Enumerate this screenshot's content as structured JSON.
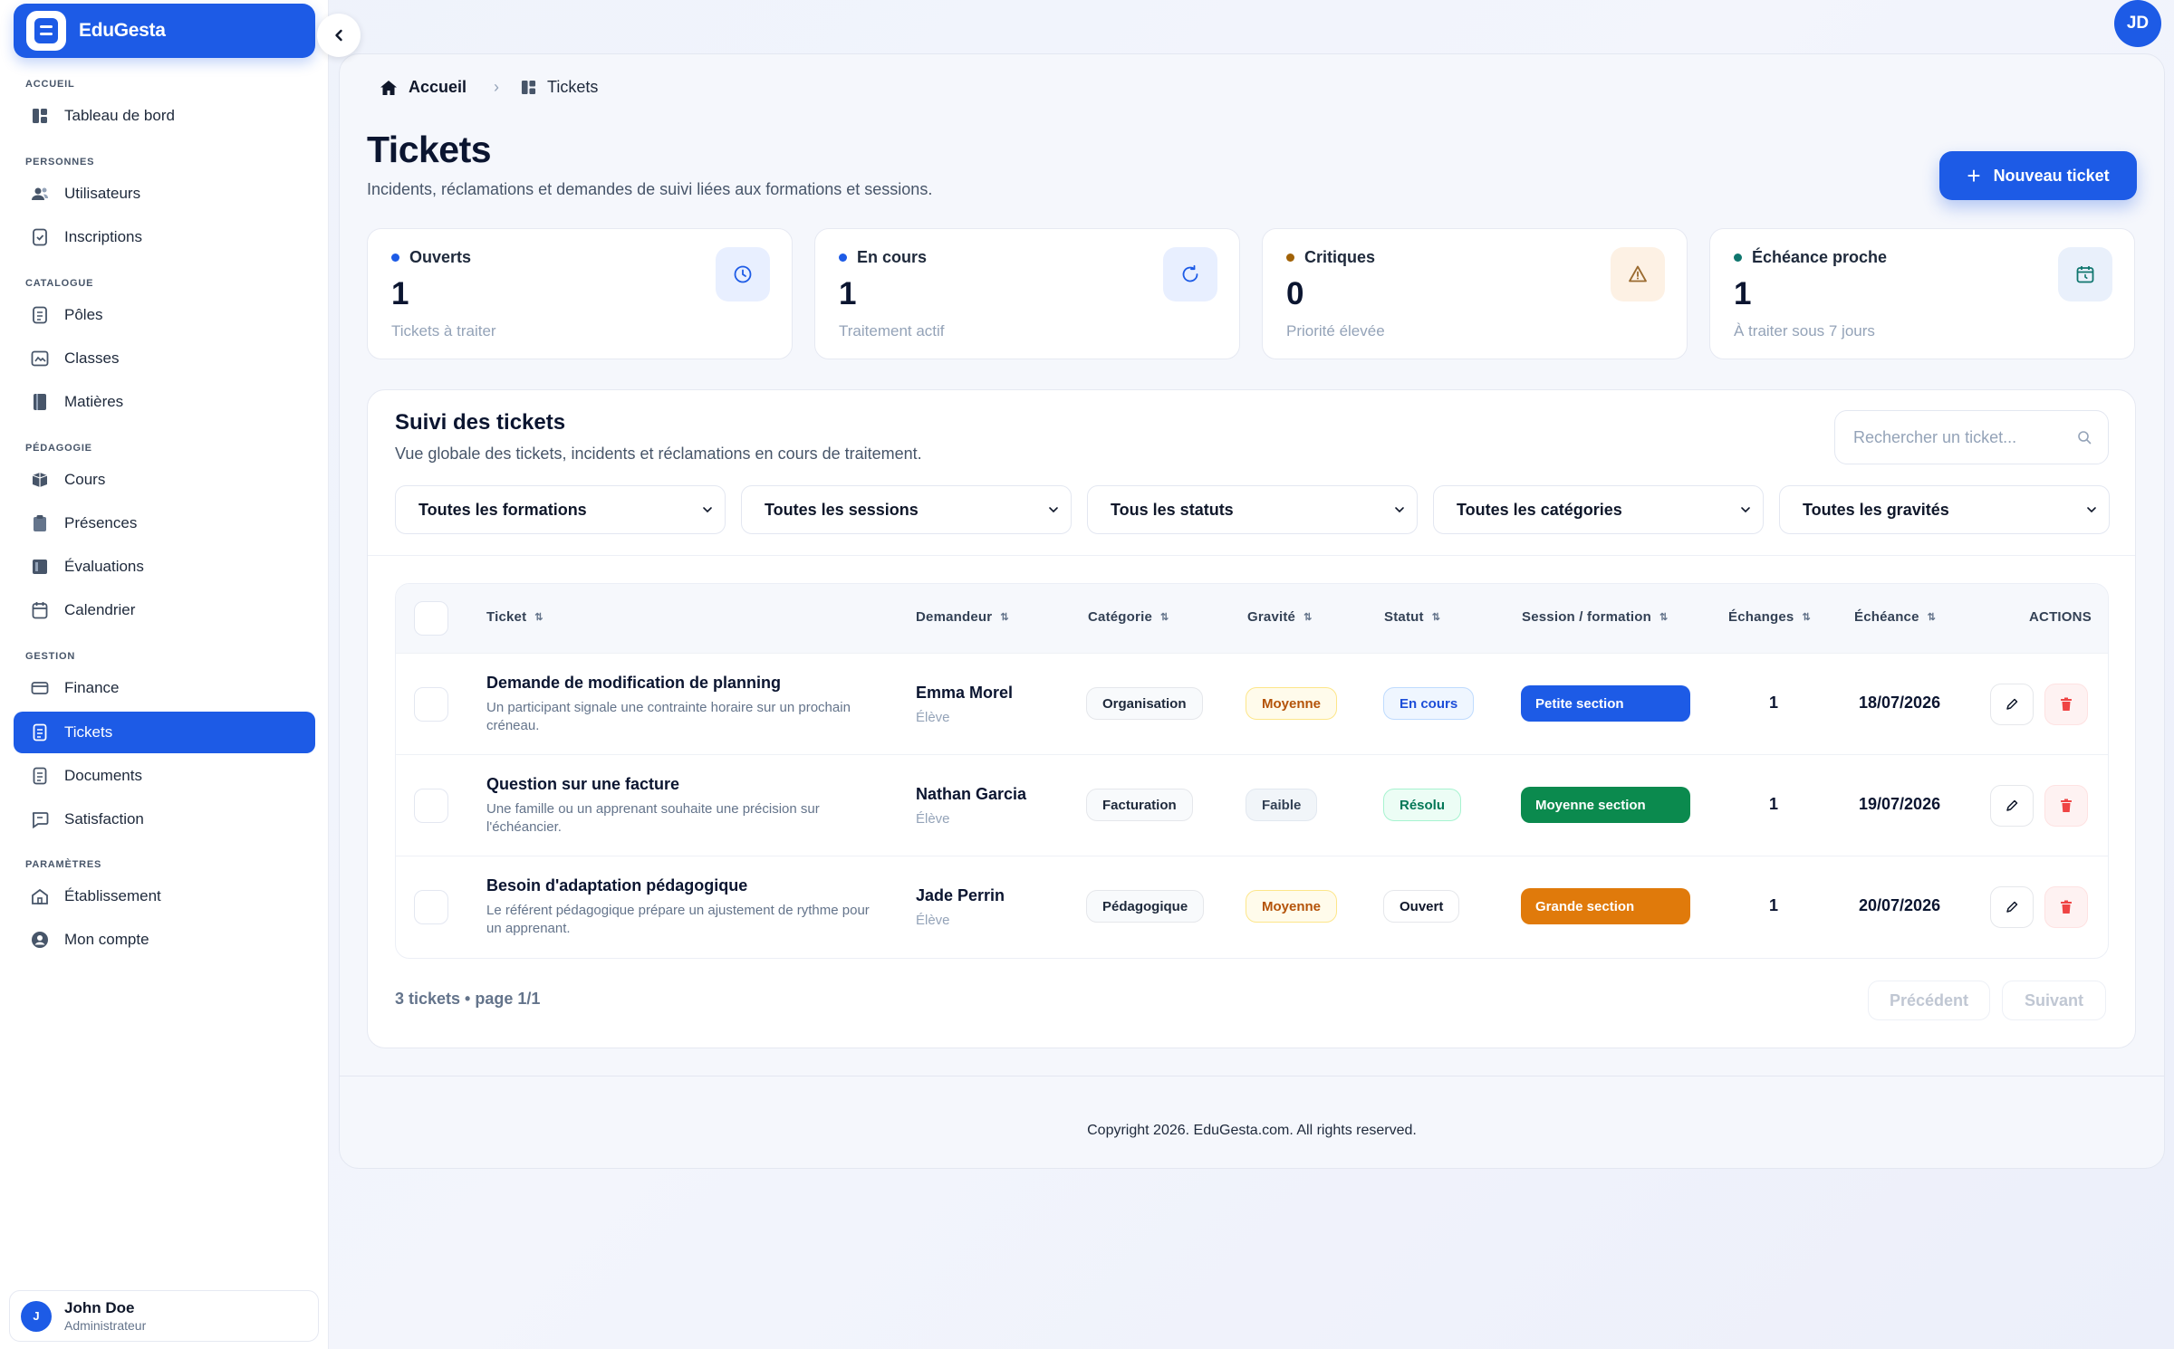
{
  "app": {
    "name": "EduGesta"
  },
  "sidebar": {
    "sections": [
      {
        "label": "Accueil",
        "items": [
          {
            "label": "Tableau de bord",
            "icon": "dashboard-icon"
          }
        ]
      },
      {
        "label": "Personnes",
        "items": [
          {
            "label": "Utilisateurs",
            "icon": "users-icon"
          },
          {
            "label": "Inscriptions",
            "icon": "enrollment-icon"
          }
        ]
      },
      {
        "label": "Catalogue",
        "items": [
          {
            "label": "Pôles",
            "icon": "poles-icon"
          },
          {
            "label": "Classes",
            "icon": "classes-icon"
          },
          {
            "label": "Matières",
            "icon": "book-icon"
          }
        ]
      },
      {
        "label": "Pédagogie",
        "items": [
          {
            "label": "Cours",
            "icon": "cours-icon"
          },
          {
            "label": "Présences",
            "icon": "clipboard-icon"
          },
          {
            "label": "Évaluations",
            "icon": "evaluations-icon"
          },
          {
            "label": "Calendrier",
            "icon": "calendar-icon"
          }
        ]
      },
      {
        "label": "Gestion",
        "items": [
          {
            "label": "Finance",
            "icon": "wallet-icon"
          },
          {
            "label": "Tickets",
            "icon": "ticket-icon",
            "active": true
          },
          {
            "label": "Documents",
            "icon": "document-icon"
          },
          {
            "label": "Satisfaction",
            "icon": "chat-icon"
          }
        ]
      },
      {
        "label": "Paramètres",
        "items": [
          {
            "label": "Établissement",
            "icon": "building-icon"
          },
          {
            "label": "Mon compte",
            "icon": "account-icon"
          }
        ]
      }
    ],
    "user": {
      "initial": "J",
      "name": "John Doe",
      "role": "Administrateur"
    }
  },
  "topbar": {
    "avatar_initials": "JD"
  },
  "breadcrumb": {
    "home": "Accueil",
    "current": "Tickets"
  },
  "header": {
    "title": "Tickets",
    "subtitle": "Incidents, réclamations et demandes de suivi liées aux formations et sessions.",
    "new_button": "Nouveau ticket"
  },
  "stats": [
    {
      "label": "Ouverts",
      "value": "1",
      "hint": "Tickets à traiter",
      "dot": "#1d5be6",
      "icon": "clock-icon",
      "icon_bg": "#e8efff",
      "icon_color": "#1d5be6"
    },
    {
      "label": "En cours",
      "value": "1",
      "hint": "Traitement actif",
      "dot": "#1d5be6",
      "icon": "refresh-icon",
      "icon_bg": "#e8efff",
      "icon_color": "#1d5be6"
    },
    {
      "label": "Critiques",
      "value": "0",
      "hint": "Priorité élevée",
      "dot": "#a16207",
      "icon": "warning-icon",
      "icon_bg": "#fdf1e4",
      "icon_color": "#9a6a2f"
    },
    {
      "label": "Échéance proche",
      "value": "1",
      "hint": "À traiter sous 7 jours",
      "dot": "#0f766e",
      "icon": "calendar-clock-icon",
      "icon_bg": "#e9f0fb",
      "icon_color": "#0f766e"
    }
  ],
  "tracking": {
    "title": "Suivi des tickets",
    "subtitle": "Vue globale des tickets, incidents et réclamations en cours de traitement.",
    "search_placeholder": "Rechercher un ticket...",
    "filters": [
      "Toutes les formations",
      "Toutes les sessions",
      "Tous les statuts",
      "Toutes les catégories",
      "Toutes les gravités"
    ]
  },
  "table": {
    "columns": {
      "ticket": "Ticket",
      "requester": "Demandeur",
      "category": "Catégorie",
      "severity": "Gravité",
      "status": "Statut",
      "session": "Session / formation",
      "exchanges": "Échanges",
      "due": "Échéance",
      "actions": "ACTIONS"
    },
    "rows": [
      {
        "title": "Demande de modification de planning",
        "description": "Un participant signale une contrainte horaire sur un prochain créneau.",
        "requester": "Emma Morel",
        "requester_role": "Élève",
        "category": "Organisation",
        "severity": "Moyenne",
        "status": "En cours",
        "session": "Petite section",
        "session_color": "#1d5be6",
        "exchanges": "1",
        "due": "18/07/2026"
      },
      {
        "title": "Question sur une facture",
        "description": "Une famille ou un apprenant souhaite une précision sur l'échéancier.",
        "requester": "Nathan Garcia",
        "requester_role": "Élève",
        "category": "Facturation",
        "severity": "Faible",
        "status": "Résolu",
        "session": "Moyenne section",
        "session_color": "#0b8a4e",
        "exchanges": "1",
        "due": "19/07/2026"
      },
      {
        "title": "Besoin d'adaptation pédagogique",
        "description": "Le référent pédagogique prépare un ajustement de rythme pour un apprenant.",
        "requester": "Jade Perrin",
        "requester_role": "Élève",
        "category": "Pédagogique",
        "severity": "Moyenne",
        "status": "Ouvert",
        "session": "Grande section",
        "session_color": "#e07a0b",
        "exchanges": "1",
        "due": "20/07/2026"
      }
    ]
  },
  "pagination": {
    "info": "3 tickets • page 1/1",
    "prev": "Précédent",
    "next": "Suivant"
  },
  "footer": {
    "text": "Copyright 2026. EduGesta.com. All rights reserved."
  }
}
